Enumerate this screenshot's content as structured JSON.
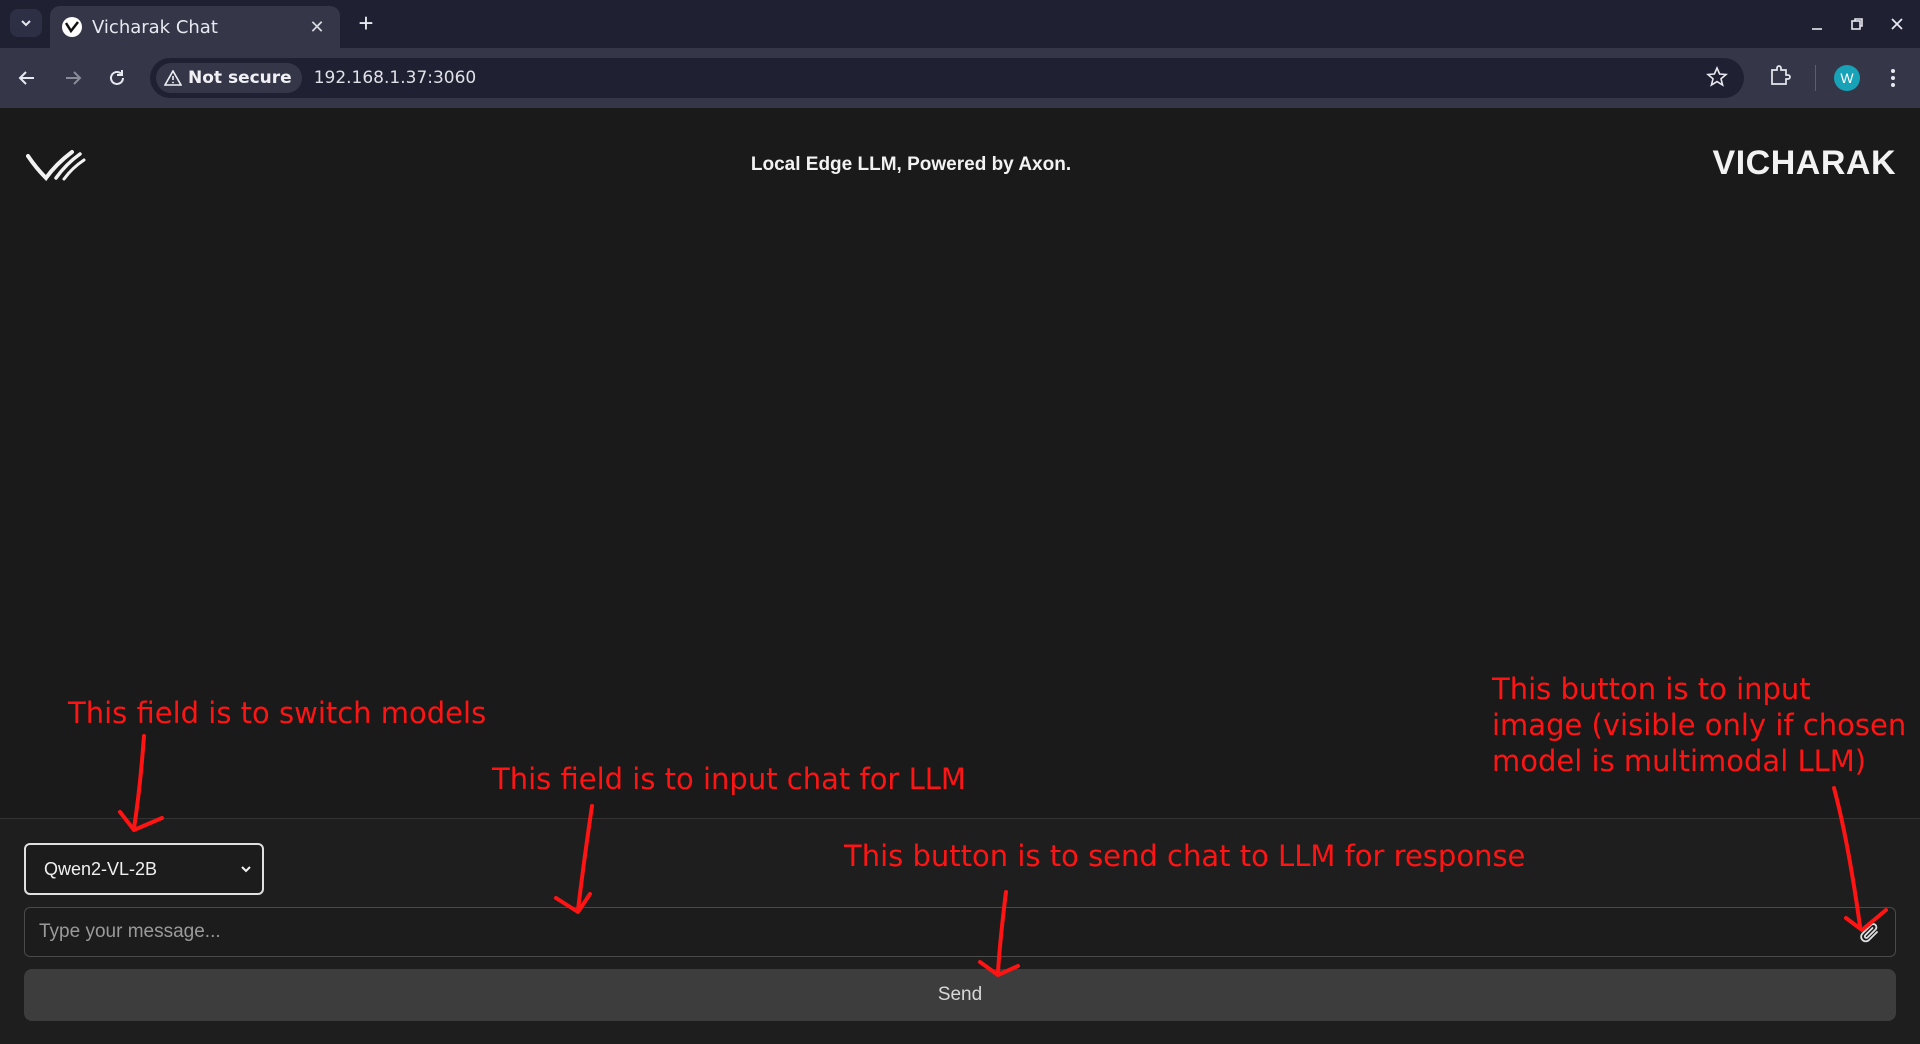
{
  "browser": {
    "tab_title": "Vicharak Chat",
    "security_label": "Not secure",
    "url": "192.168.1.37:3060",
    "profile_initial": "W"
  },
  "app": {
    "tagline": "Local Edge LLM, Powered by Axon.",
    "brand": "VICHARAK"
  },
  "composer": {
    "selected_model": "Qwen2-VL-2B",
    "message_placeholder": "Type your message...",
    "send_label": "Send"
  },
  "annotations": {
    "model_switch": "This field is to switch models",
    "chat_input": "This field is to input chat for LLM",
    "send_button": "This button is to send chat to LLM for response",
    "image_button_line1": "This button is to input",
    "image_button_line2": "image (visible only if chosen",
    "image_button_line3": "model is multimodal LLM)"
  },
  "colors": {
    "annotation": "#ff1414",
    "background": "#1a1a1a",
    "avatar": "#17a2b8"
  }
}
